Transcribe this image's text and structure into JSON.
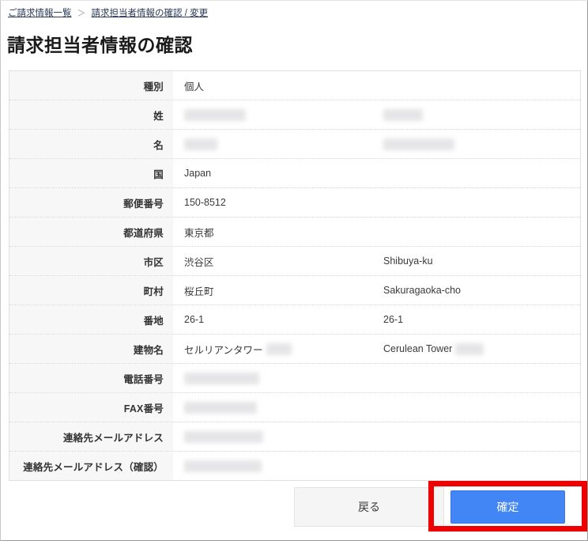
{
  "breadcrumb": {
    "items": [
      {
        "label": "ご請求情報一覧"
      },
      {
        "label": "請求担当者情報の確認 / 変更"
      }
    ],
    "separator": "＞"
  },
  "page": {
    "title": "請求担当者情報の確認"
  },
  "table": {
    "rows": [
      {
        "label": "種別",
        "value": "個人",
        "value_en": "",
        "value_redacted": false,
        "value_redacted_width": 0,
        "value_en_redacted": false,
        "value_en_redacted_width": 0,
        "trailing_redacted_width": 0,
        "trailing_redacted_width_en": 0
      },
      {
        "label": "姓",
        "value": "",
        "value_en": "",
        "value_redacted": true,
        "value_redacted_width": 78,
        "value_en_redacted": true,
        "value_en_redacted_width": 50,
        "trailing_redacted_width": 0,
        "trailing_redacted_width_en": 0
      },
      {
        "label": "名",
        "value": "",
        "value_en": "",
        "value_redacted": true,
        "value_redacted_width": 42,
        "value_en_redacted": true,
        "value_en_redacted_width": 90,
        "trailing_redacted_width": 0,
        "trailing_redacted_width_en": 0
      },
      {
        "label": "国",
        "value": "Japan",
        "value_en": "",
        "value_redacted": false,
        "value_redacted_width": 0,
        "value_en_redacted": false,
        "value_en_redacted_width": 0,
        "trailing_redacted_width": 0,
        "trailing_redacted_width_en": 0
      },
      {
        "label": "郵便番号",
        "value": "150-8512",
        "value_en": "",
        "value_redacted": false,
        "value_redacted_width": 0,
        "value_en_redacted": false,
        "value_en_redacted_width": 0,
        "trailing_redacted_width": 0,
        "trailing_redacted_width_en": 0
      },
      {
        "label": "都道府県",
        "value": "東京都",
        "value_en": "",
        "value_redacted": false,
        "value_redacted_width": 0,
        "value_en_redacted": false,
        "value_en_redacted_width": 0,
        "trailing_redacted_width": 0,
        "trailing_redacted_width_en": 0
      },
      {
        "label": "市区",
        "value": "渋谷区",
        "value_en": "Shibuya-ku",
        "value_redacted": false,
        "value_redacted_width": 0,
        "value_en_redacted": false,
        "value_en_redacted_width": 0,
        "trailing_redacted_width": 0,
        "trailing_redacted_width_en": 0
      },
      {
        "label": "町村",
        "value": "桜丘町",
        "value_en": "Sakuragaoka-cho",
        "value_redacted": false,
        "value_redacted_width": 0,
        "value_en_redacted": false,
        "value_en_redacted_width": 0,
        "trailing_redacted_width": 0,
        "trailing_redacted_width_en": 0
      },
      {
        "label": "番地",
        "value": "26-1",
        "value_en": "26-1",
        "value_redacted": false,
        "value_redacted_width": 0,
        "value_en_redacted": false,
        "value_en_redacted_width": 0,
        "trailing_redacted_width": 0,
        "trailing_redacted_width_en": 0
      },
      {
        "label": "建物名",
        "value": "セルリアンタワー",
        "value_en": "Cerulean Tower",
        "value_redacted": false,
        "value_redacted_width": 0,
        "value_en_redacted": false,
        "value_en_redacted_width": 0,
        "trailing_redacted_width": 32,
        "trailing_redacted_width_en": 36
      },
      {
        "label": "電話番号",
        "value": "",
        "value_en": "",
        "value_redacted": true,
        "value_redacted_width": 95,
        "value_en_redacted": false,
        "value_en_redacted_width": 0,
        "trailing_redacted_width": 0,
        "trailing_redacted_width_en": 0
      },
      {
        "label": "FAX番号",
        "value": "",
        "value_en": "",
        "value_redacted": true,
        "value_redacted_width": 92,
        "value_en_redacted": false,
        "value_en_redacted_width": 0,
        "trailing_redacted_width": 0,
        "trailing_redacted_width_en": 0
      },
      {
        "label": "連絡先メールアドレス",
        "value": "",
        "value_en": "",
        "value_redacted": true,
        "value_redacted_width": 100,
        "value_en_redacted": false,
        "value_en_redacted_width": 0,
        "trailing_redacted_width": 0,
        "trailing_redacted_width_en": 0
      },
      {
        "label": "連絡先メールアドレス（確認）",
        "value": "",
        "value_en": "",
        "value_redacted": true,
        "value_redacted_width": 98,
        "value_en_redacted": false,
        "value_en_redacted_width": 0,
        "trailing_redacted_width": 0,
        "trailing_redacted_width_en": 0
      }
    ]
  },
  "footer": {
    "back_label": "戻る",
    "confirm_label": "確定"
  },
  "colors": {
    "accent_blue": "#4285f4",
    "highlight_red": "#ee0000",
    "label_bg": "#f7f7f7",
    "back_bg": "#f5f5f5"
  }
}
